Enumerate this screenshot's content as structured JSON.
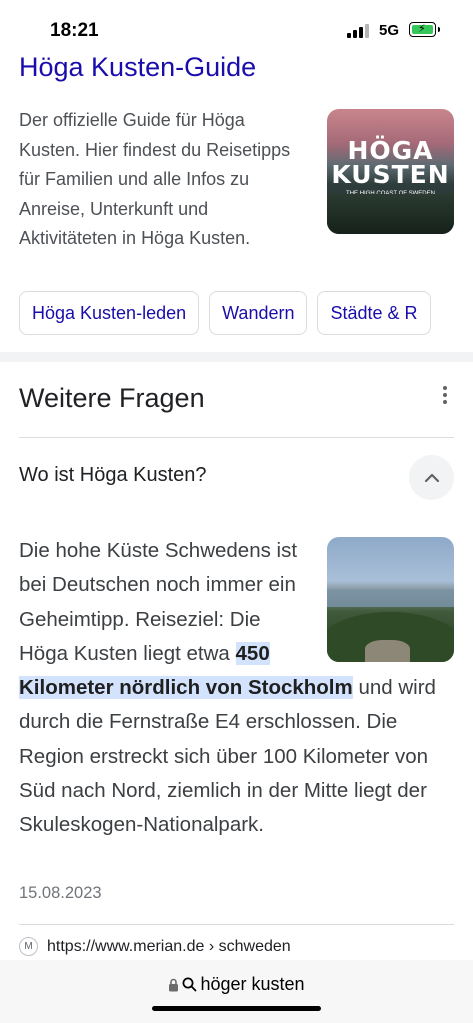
{
  "status": {
    "time": "18:21",
    "network": "5G"
  },
  "result": {
    "title": "Höga Kusten-Guide",
    "description": "Der offizielle Guide für Höga Kusten. Hier findest du Reisetipps für Familien und alle Infos zu Anreise, Unterkunft und Aktivitäteten in Höga Kusten.",
    "thumbnail_logo_line1": "HÖGA",
    "thumbnail_logo_line2": "KUSTEN",
    "thumbnail_caption": "THE HIGH COAST OF SWEDEN",
    "chips": [
      "Höga Kusten-leden",
      "Wandern",
      "Städte & R"
    ]
  },
  "paa": {
    "heading": "Weitere Fragen",
    "question": "Wo ist Höga Kusten?",
    "answer_before": "Die hohe Küste Schwedens ist bei Deutschen noch immer ein Geheimtipp. Reiseziel: Die Höga Kusten liegt etwa ",
    "answer_highlight": "450 Kilometer nördlich von Stockholm",
    "answer_after": " und wird durch die Fernstraße E4 erschlossen. Die Region erstreckt sich über 100 Kilometer von Süd nach Nord, ziemlich in der Mitte liegt der Skuleskogen-Nationalpark.",
    "date": "15.08.2023",
    "source_url": "https://www.merian.de › schweden",
    "source_icon_letter": "M"
  },
  "urlbar": {
    "query": "höger kusten"
  },
  "icons": {
    "lock": "lock-icon",
    "search": "search-icon",
    "more": "more-vert-icon",
    "collapse": "chevron-up-icon"
  }
}
